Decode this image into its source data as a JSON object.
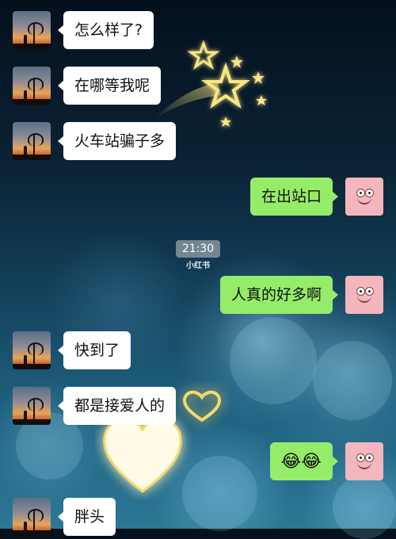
{
  "chat": {
    "messages": [
      {
        "side": "left",
        "text": "怎么样了?"
      },
      {
        "side": "left",
        "text": "在哪等我呢"
      },
      {
        "side": "left",
        "text": "火车站骗子多"
      },
      {
        "side": "right",
        "text": "在出站口"
      },
      {
        "side": "right",
        "text": "人真的好多啊"
      },
      {
        "side": "left",
        "text": "快到了"
      },
      {
        "side": "left",
        "text": "都是接爱人的"
      },
      {
        "side": "right",
        "text": "😂😂"
      },
      {
        "side": "left",
        "text": "胖头"
      }
    ],
    "timestamp": "21:30"
  },
  "watermark": "小红书",
  "icons": {
    "left_avatar": "sunset-tree-avatar",
    "right_avatar": "patrick-star-avatar",
    "decor": [
      "glowing-stars-icon",
      "glowing-heart-icon"
    ]
  },
  "colors": {
    "incoming_bubble": "#ffffff",
    "outgoing_bubble": "#95ec69",
    "star_glow": "#f6e27a"
  }
}
